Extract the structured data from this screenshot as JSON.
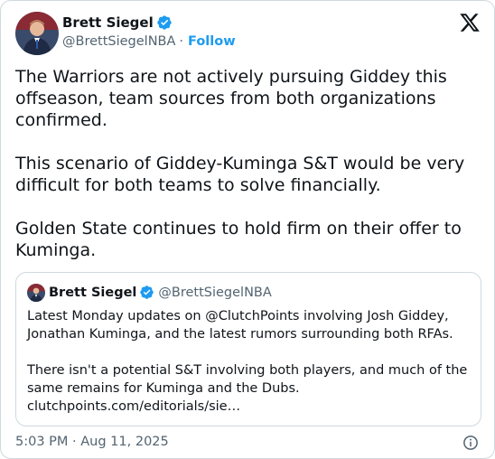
{
  "author": {
    "name": "Brett Siegel",
    "handle": "@BrettSiegelNBA",
    "separator": "·",
    "follow_label": "Follow"
  },
  "tweet": {
    "paragraphs": [
      "The Warriors are not actively pursuing Giddey this offseason, team sources from both organizations confirmed.",
      "This scenario of Giddey-Kuminga S&T would be very difficult for both teams to solve financially.",
      "Golden State continues to hold firm on their offer to Kuminga."
    ],
    "timestamp": "5:03 PM · Aug 11, 2025"
  },
  "quote": {
    "name": "Brett Siegel",
    "handle": "@BrettSiegelNBA",
    "paragraphs": [
      "Latest Monday updates on @ClutchPoints involving Josh Giddey, Jonathan Kuminga, and the latest rumors surrounding both RFAs.",
      "There isn't a potential S&T involving both players, and much of the same remains for Kuminga and the Dubs. clutchpoints.com/editorials/sie…"
    ]
  },
  "icons": {
    "verified": "verified-badge-icon",
    "logo": "x-logo-icon",
    "info": "info-icon"
  },
  "colors": {
    "accent": "#1d9bf0",
    "text": "#0f1419",
    "secondary": "#536471",
    "border": "#cfd9de"
  }
}
